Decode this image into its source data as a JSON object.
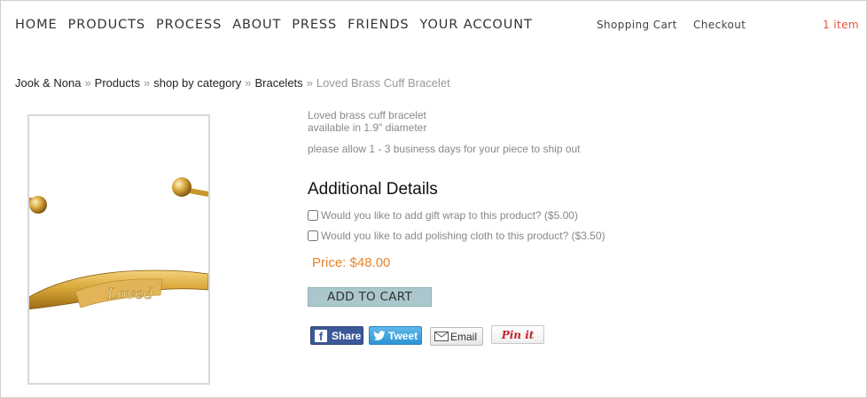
{
  "nav": {
    "items": [
      "HOME",
      "PRODUCTS",
      "PROCESS",
      "ABOUT",
      "PRESS",
      "FRIENDS",
      "YOUR ACCOUNT"
    ],
    "shopping_cart": "Shopping Cart",
    "checkout": "Checkout",
    "cart_count": "1 item"
  },
  "breadcrumb": {
    "items": [
      "Jook & Nona",
      "Products",
      "shop by category",
      "Bracelets"
    ],
    "separator": "»",
    "current": "Loved Brass Cuff Bracelet"
  },
  "product": {
    "image_alt": "brass-cuff-bracelet-photo",
    "engraving": "Loved",
    "description_line1": "Loved brass cuff bracelet",
    "description_line2": "available in 1.9\" diameter",
    "shipping_note": "please allow 1 - 3 business days for your piece to ship out",
    "additional_heading": "Additional Details",
    "options": [
      {
        "label": "Would you like to add gift wrap to this product? ($5.00)",
        "checked": false
      },
      {
        "label": "Would you like to add polishing cloth to this product? ($3.50)",
        "checked": false
      }
    ],
    "price": "Price: $48.00",
    "add_to_cart": "ADD TO CART"
  },
  "share": {
    "facebook": "Share",
    "twitter": "Tweet",
    "email": "Email",
    "pinterest": "Pin it"
  },
  "colors": {
    "accent_price": "#e8862a",
    "cart_count": "#e2553a",
    "add_to_cart_bg": "#a9c7cc",
    "facebook": "#3b5998",
    "twitter": "#2d94d4",
    "pinterest": "#c8232c"
  }
}
